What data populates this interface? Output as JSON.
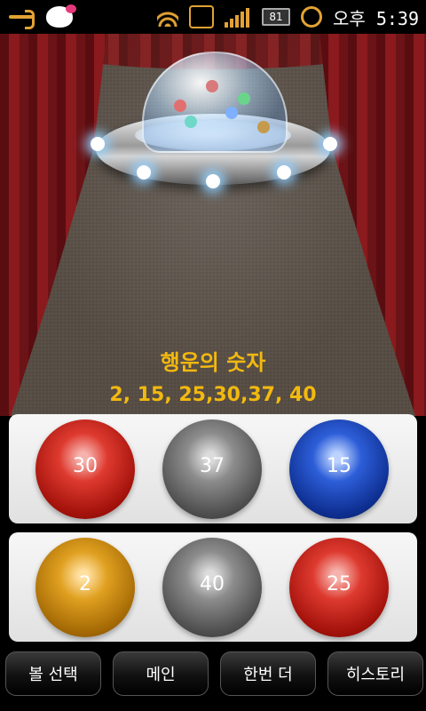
{
  "status_bar": {
    "icons_left": [
      "usb-icon",
      "hello-kitty-icon"
    ],
    "icons_right": [
      "wifi-icon",
      "vibrate-icon",
      "signal-icon",
      "battery-icon",
      "alarm-icon"
    ],
    "battery_level": "81",
    "time": "오후 5:39",
    "accent_color": "#e3a233"
  },
  "main": {
    "title": "행운의 숫자",
    "numbers_text": "2, 15, 25,30,37, 40",
    "text_color": "#f2b90f"
  },
  "balls": {
    "row1": [
      {
        "number": "30",
        "color": "red"
      },
      {
        "number": "37",
        "color": "gray"
      },
      {
        "number": "15",
        "color": "blue"
      }
    ],
    "row2": [
      {
        "number": "2",
        "color": "orange"
      },
      {
        "number": "40",
        "color": "gray"
      },
      {
        "number": "25",
        "color": "red"
      }
    ]
  },
  "buttons": {
    "ball_select": "볼 선택",
    "main": "메인",
    "again": "한번 더",
    "history": "히스토리"
  }
}
